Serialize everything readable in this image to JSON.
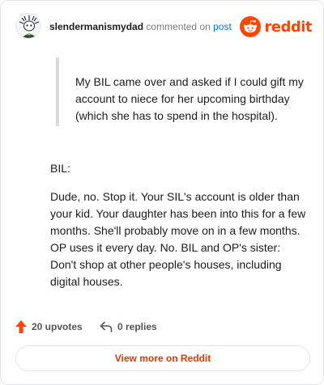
{
  "header": {
    "username": "slendermanismydad",
    "action": "commented on",
    "post_link": "post",
    "brand_word": "reddit"
  },
  "comment": {
    "quote": "My BIL came over and asked if I could gift my account to niece for her upcoming birthday (which she has to spend in the hospital).",
    "paragraph_1": "BIL:",
    "paragraph_2": "Dude, no. Stop it. Your SIL's account is older than your kid. Your daughter has been into this for a few months. She'll probably move on in a few months. OP uses it every day. No. BIL and OP's sister: Don't shop at other people's houses, including digital houses."
  },
  "footer": {
    "upvotes": "20 upvotes",
    "replies": "0 replies",
    "view_more": "View more on Reddit"
  },
  "colors": {
    "brand": "#ff4500",
    "link": "#0079d3",
    "view_more_text": "#d93a00"
  },
  "icons": {
    "avatar": "snoo-avatar",
    "brand": "reddit-alien-icon",
    "upvote": "upvote-arrow-icon",
    "reply": "reply-arrow-icon"
  }
}
